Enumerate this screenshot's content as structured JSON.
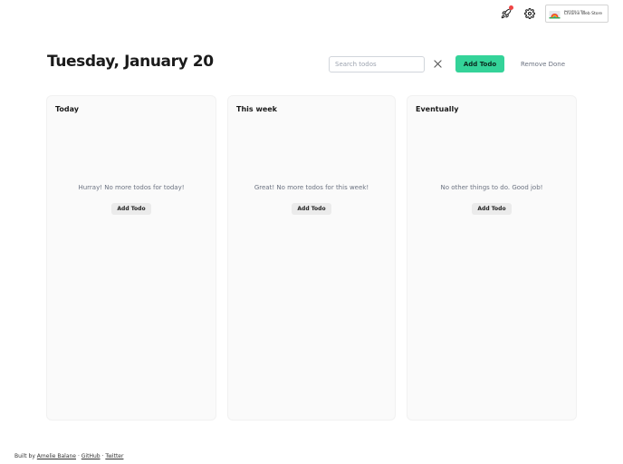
{
  "header": {
    "title": "Tuesday, January 20",
    "store_badge_small": "Available in the",
    "store_badge_big": "Chrome Web Store",
    "icons": [
      "rocket-icon",
      "gear-icon",
      "chrome-logo-icon"
    ],
    "notification_color": "#ef4444"
  },
  "controls": {
    "search_placeholder": "Search todos",
    "search_value": "",
    "add_label": "Add Todo",
    "remove_label": "Remove Done",
    "accent_color": "#34d399"
  },
  "columns": [
    {
      "title": "Today",
      "empty_text": "Hurray! No more todos for today!",
      "button": "Add Todo"
    },
    {
      "title": "This week",
      "empty_text": "Great! No more todos for this week!",
      "button": "Add Todo"
    },
    {
      "title": "Eventually",
      "empty_text": "No other things to do. Good job!",
      "button": "Add Todo"
    }
  ],
  "footer": {
    "prefix": "Built by",
    "author": "Amelie Balane",
    "sep1": "·",
    "github": "GitHub",
    "sep2": "·",
    "twitter": "Twitter"
  }
}
